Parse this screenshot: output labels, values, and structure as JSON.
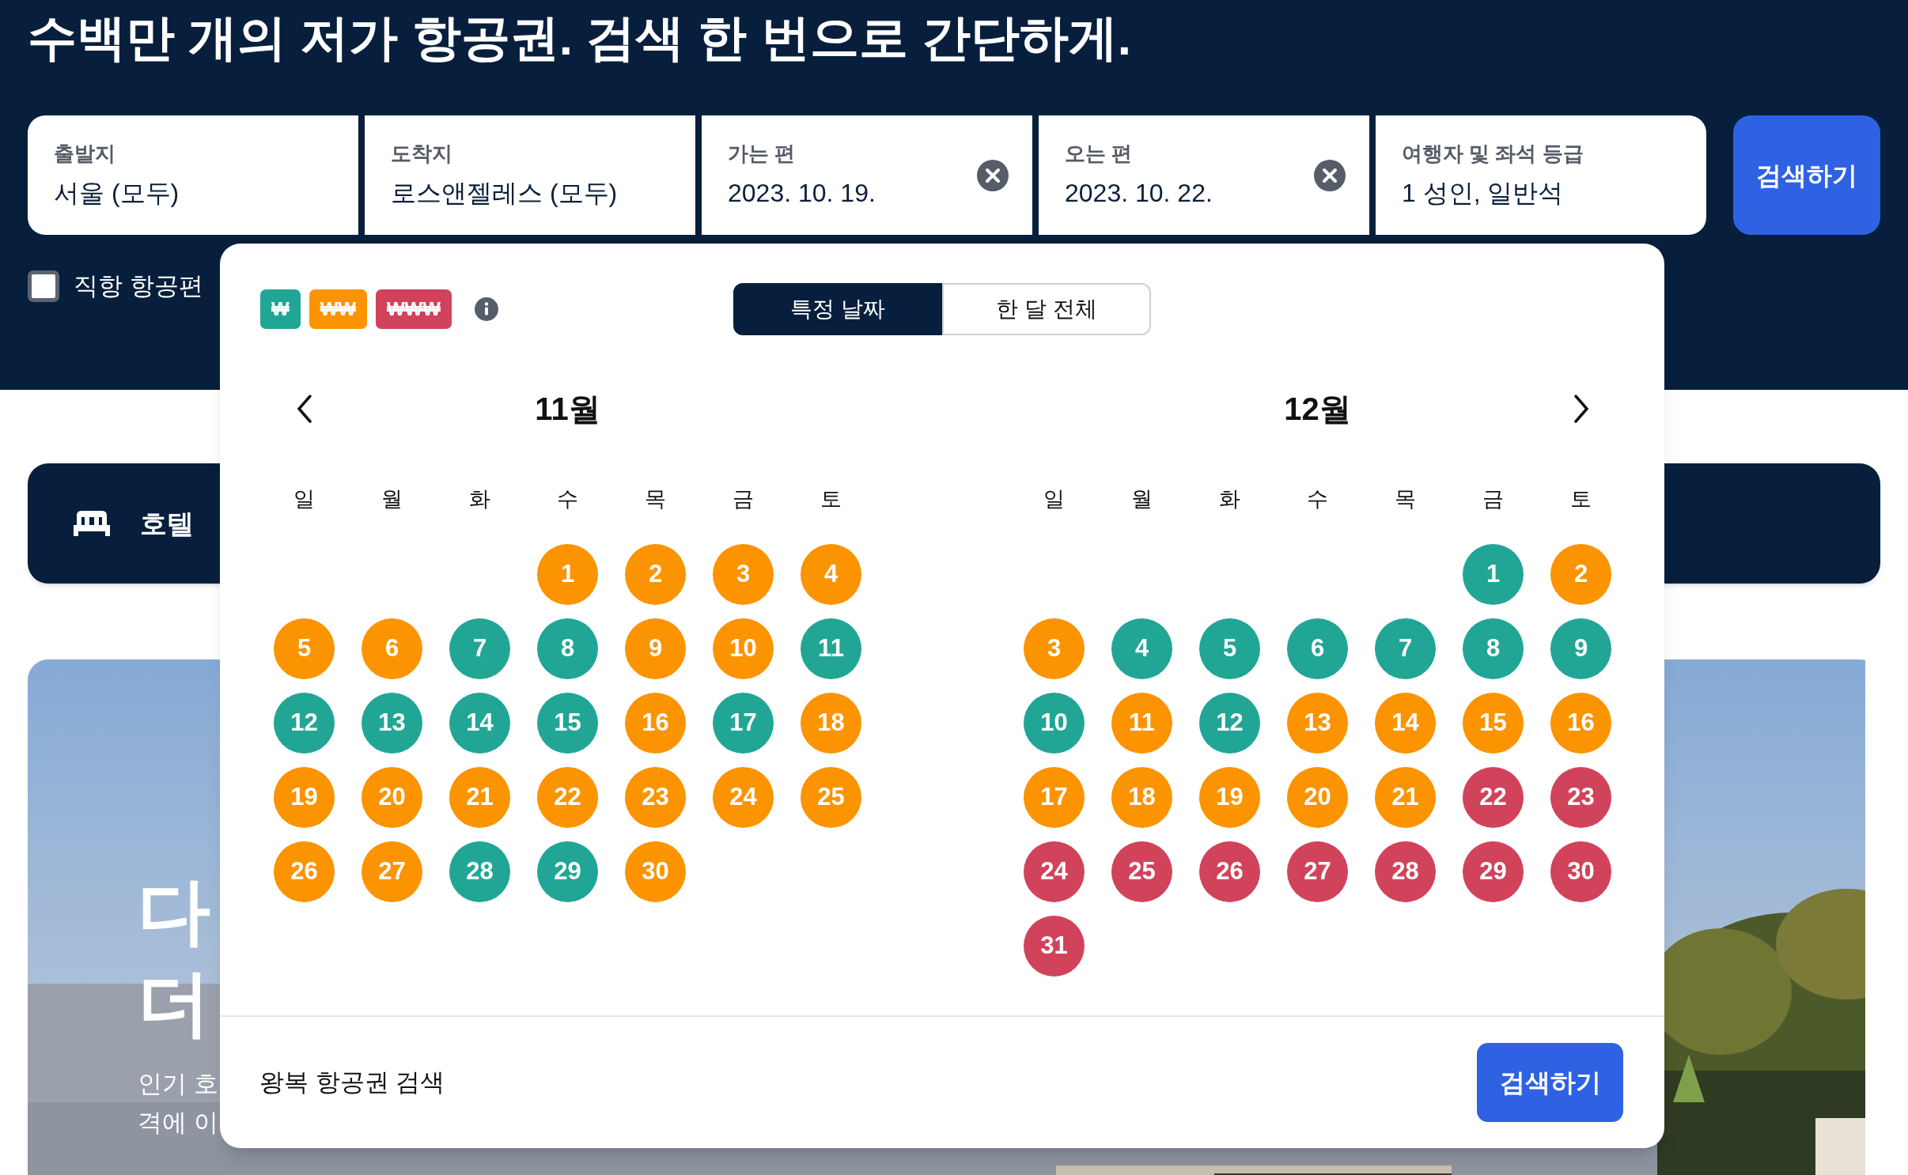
{
  "headline": "수백만 개의 저가 항공권. 검색 한 번으로 간단하게.",
  "search_fields": [
    {
      "label": "출발지",
      "value": "서울 (모두)",
      "clearable": false
    },
    {
      "label": "도착지",
      "value": "로스앤젤레스 (모두)",
      "clearable": false
    },
    {
      "label": "가는 편",
      "value": "2023. 10. 19.",
      "clearable": true
    },
    {
      "label": "오는 편",
      "value": "2023. 10. 22.",
      "clearable": true
    },
    {
      "label": "여행자 및 좌석 등급",
      "value": "1 성인, 일반석",
      "clearable": false
    }
  ],
  "search_button": "검색하기",
  "direct_flights": {
    "label": "직항 항공편",
    "checked": false
  },
  "hotel_tab": {
    "label": "호텔"
  },
  "promo": {
    "heading_lines": [
      "다",
      "더"
    ],
    "body_lines": [
      "인기 호",
      "격에 이"
    ]
  },
  "date_picker": {
    "legend": [
      {
        "label": "₩",
        "color": "#21a696"
      },
      {
        "label": "₩₩",
        "color": "#fb9400"
      },
      {
        "label": "₩₩₩",
        "color": "#d1435b"
      }
    ],
    "modes": [
      {
        "label": "특정 날짜",
        "selected": true
      },
      {
        "label": "한 달 전체",
        "selected": false
      }
    ],
    "months": [
      {
        "title": "11월",
        "weekdays": [
          "일",
          "월",
          "화",
          "수",
          "목",
          "금",
          "토"
        ],
        "weeks": [
          [
            {
              "day": "1",
              "color": "#fb9400"
            },
            {
              "day": "2",
              "color": "#fb9400"
            },
            {
              "day": "3",
              "color": "#fb9400"
            },
            {
              "day": "4",
              "color": "#fb9400"
            }
          ],
          [
            {
              "day": "5",
              "color": "#fb9400"
            },
            {
              "day": "6",
              "color": "#fb9400"
            },
            {
              "day": "7",
              "color": "#21a696"
            },
            {
              "day": "8",
              "color": "#21a696"
            },
            {
              "day": "9",
              "color": "#fb9400"
            },
            {
              "day": "10",
              "color": "#fb9400"
            },
            {
              "day": "11",
              "color": "#21a696"
            }
          ],
          [
            {
              "day": "12",
              "color": "#21a696"
            },
            {
              "day": "13",
              "color": "#21a696"
            },
            {
              "day": "14",
              "color": "#21a696"
            },
            {
              "day": "15",
              "color": "#21a696"
            },
            {
              "day": "16",
              "color": "#fb9400"
            },
            {
              "day": "17",
              "color": "#21a696"
            },
            {
              "day": "18",
              "color": "#fb9400"
            }
          ],
          [
            {
              "day": "19",
              "color": "#fb9400"
            },
            {
              "day": "20",
              "color": "#fb9400"
            },
            {
              "day": "21",
              "color": "#fb9400"
            },
            {
              "day": "22",
              "color": "#fb9400"
            },
            {
              "day": "23",
              "color": "#fb9400"
            },
            {
              "day": "24",
              "color": "#fb9400"
            },
            {
              "day": "25",
              "color": "#fb9400"
            }
          ],
          [
            {
              "day": "26",
              "color": "#fb9400"
            },
            {
              "day": "27",
              "color": "#fb9400"
            },
            {
              "day": "28",
              "color": "#21a696"
            },
            {
              "day": "29",
              "color": "#21a696"
            },
            {
              "day": "30",
              "color": "#fb9400"
            }
          ]
        ]
      },
      {
        "title": "12월",
        "weekdays": [
          "일",
          "월",
          "화",
          "수",
          "목",
          "금",
          "토"
        ],
        "weeks": [
          [
            {
              "day": "1",
              "color": "#21a696"
            },
            {
              "day": "2",
              "color": "#fb9400"
            }
          ],
          [
            {
              "day": "3",
              "color": "#fb9400"
            },
            {
              "day": "4",
              "color": "#21a696"
            },
            {
              "day": "5",
              "color": "#21a696"
            },
            {
              "day": "6",
              "color": "#21a696"
            },
            {
              "day": "7",
              "color": "#21a696"
            },
            {
              "day": "8",
              "color": "#21a696"
            },
            {
              "day": "9",
              "color": "#21a696"
            }
          ],
          [
            {
              "day": "10",
              "color": "#21a696"
            },
            {
              "day": "11",
              "color": "#fb9400"
            },
            {
              "day": "12",
              "color": "#21a696"
            },
            {
              "day": "13",
              "color": "#fb9400"
            },
            {
              "day": "14",
              "color": "#fb9400"
            },
            {
              "day": "15",
              "color": "#fb9400"
            },
            {
              "day": "16",
              "color": "#fb9400"
            }
          ],
          [
            {
              "day": "17",
              "color": "#fb9400"
            },
            {
              "day": "18",
              "color": "#fb9400"
            },
            {
              "day": "19",
              "color": "#fb9400"
            },
            {
              "day": "20",
              "color": "#fb9400"
            },
            {
              "day": "21",
              "color": "#fb9400"
            },
            {
              "day": "22",
              "color": "#d1435b"
            },
            {
              "day": "23",
              "color": "#d1435b"
            }
          ],
          [
            {
              "day": "24",
              "color": "#d1435b"
            },
            {
              "day": "25",
              "color": "#d1435b"
            },
            {
              "day": "26",
              "color": "#d1435b"
            },
            {
              "day": "27",
              "color": "#d1435b"
            },
            {
              "day": "28",
              "color": "#d1435b"
            },
            {
              "day": "29",
              "color": "#d1435b"
            },
            {
              "day": "30",
              "color": "#d1435b"
            }
          ],
          [
            {
              "day": "31",
              "color": "#d1435b"
            }
          ]
        ]
      }
    ],
    "footer_label": "왕복 항공권 검색",
    "footer_button": "검색하기"
  }
}
